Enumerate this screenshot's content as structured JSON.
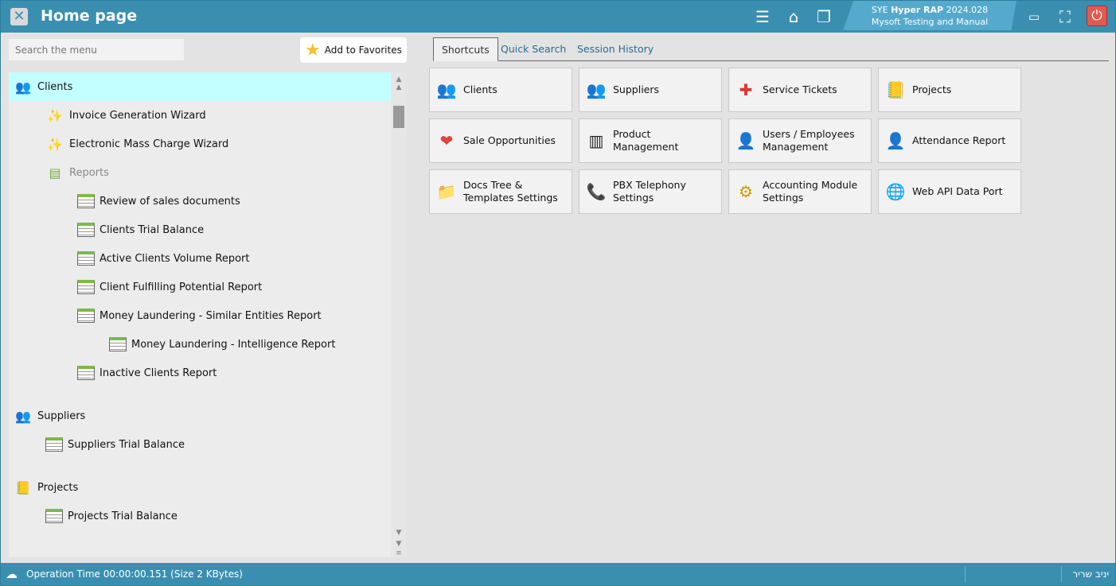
{
  "titlebar": {
    "title": "Home page",
    "brand_prefix": "SYE",
    "brand_name": "Hyper RAP",
    "version": "2024.028",
    "company": "Mysoft Testing and Manual",
    "icons": [
      "close-icon",
      "menu-icon",
      "home-icon",
      "windows-icon",
      "minimize-icon",
      "fullscreen-icon",
      "power-icon"
    ]
  },
  "sidebar": {
    "search_placeholder": "Search the menu",
    "favorites_label": "Add to Favorites",
    "tree": [
      {
        "label": "Clients",
        "icon": "clients-icon",
        "level": 0,
        "selected": true
      },
      {
        "label": "Invoice Generation Wizard",
        "icon": "wizard-icon",
        "level": 1
      },
      {
        "label": "Electronic Mass Charge Wizard",
        "icon": "wizard-icon",
        "level": 1
      },
      {
        "label": "Reports",
        "icon": "reports-folder-icon",
        "level": 1,
        "muted": true
      },
      {
        "label": "Review of sales documents",
        "icon": "report-icon",
        "level": 2
      },
      {
        "label": "Clients Trial Balance",
        "icon": "report-icon",
        "level": 2
      },
      {
        "label": "Active Clients Volume Report",
        "icon": "report-icon",
        "level": 2
      },
      {
        "label": "Client Fulfilling Potential Report",
        "icon": "report-icon",
        "level": 2
      },
      {
        "label": "Money Laundering - Similar Entities Report",
        "icon": "report-icon",
        "level": 2
      },
      {
        "label": "Money Laundering - Intelligence Report",
        "icon": "report-icon",
        "level": 3
      },
      {
        "label": "Inactive Clients Report",
        "icon": "report-icon",
        "level": 2
      },
      {
        "label": "Suppliers",
        "icon": "suppliers-icon",
        "level": 0
      },
      {
        "label": "Suppliers Trial Balance",
        "icon": "report-icon",
        "level": 1
      },
      {
        "label": "Projects",
        "icon": "projects-icon",
        "level": 0
      },
      {
        "label": "Projects Trial Balance",
        "icon": "report-icon",
        "level": 1
      }
    ]
  },
  "tabs": [
    {
      "label": "Shortcuts",
      "active": true
    },
    {
      "label": "Quick Search"
    },
    {
      "label": "Session History"
    }
  ],
  "shortcuts": [
    {
      "label": "Clients",
      "icon": "clients-icon"
    },
    {
      "label": "Suppliers",
      "icon": "suppliers-icon"
    },
    {
      "label": "Service Tickets",
      "icon": "first-aid-icon"
    },
    {
      "label": "Projects",
      "icon": "projects-icon"
    },
    {
      "label": "Sale Opportunities",
      "icon": "heart-icon"
    },
    {
      "label": "Product Management",
      "icon": "barcode-icon"
    },
    {
      "label": "Users / Employees Management",
      "icon": "users-icon"
    },
    {
      "label": "Attendance Report",
      "icon": "attendance-icon"
    },
    {
      "label": "Docs Tree & Templates Settings",
      "icon": "folder-icon"
    },
    {
      "label": "PBX Telephony Settings",
      "icon": "phone-icon"
    },
    {
      "label": "Accounting Module Settings",
      "icon": "coins-gear-icon"
    },
    {
      "label": "Web API Data Port",
      "icon": "globe-icon"
    }
  ],
  "status": {
    "text": "Operation Time  00:00:00.151   (Size 2 KBytes)",
    "user": "יניב שריר"
  }
}
